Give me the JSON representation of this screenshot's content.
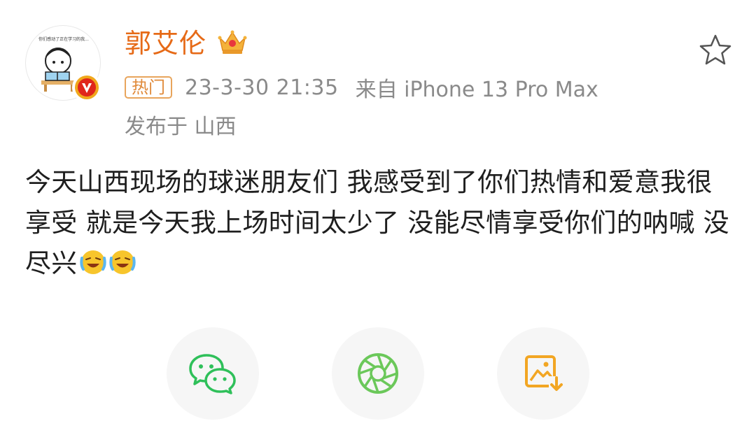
{
  "user": {
    "name": "郭艾伦",
    "avatar_caption": "你们感动了正在学习的我..."
  },
  "post": {
    "tag": "热门",
    "time": "23-3-30 21:35",
    "source": "来自 iPhone 13 Pro Max",
    "location": "发布于 山西",
    "text": "今天山西现场的球迷朋友们 我感受到了你们热情和爱意我很享受 就是今天我上场时间太少了 没能尽情享受你们的呐喊 没尽兴"
  },
  "icons": {
    "crown": "crown-icon",
    "verified": "verified-v-icon",
    "star": "star-outline-icon",
    "emoji": "crying-laughing-emoji",
    "wechat": "wechat-icon",
    "moments": "moments-shutter-icon",
    "save_image": "save-image-icon"
  },
  "colors": {
    "username": "#e66a17",
    "hot_tag": "#e08a3a",
    "meta": "#8a8a8a",
    "wechat": "#2fc05a",
    "moments": "#6bc85a",
    "save_image": "#f2a623"
  }
}
